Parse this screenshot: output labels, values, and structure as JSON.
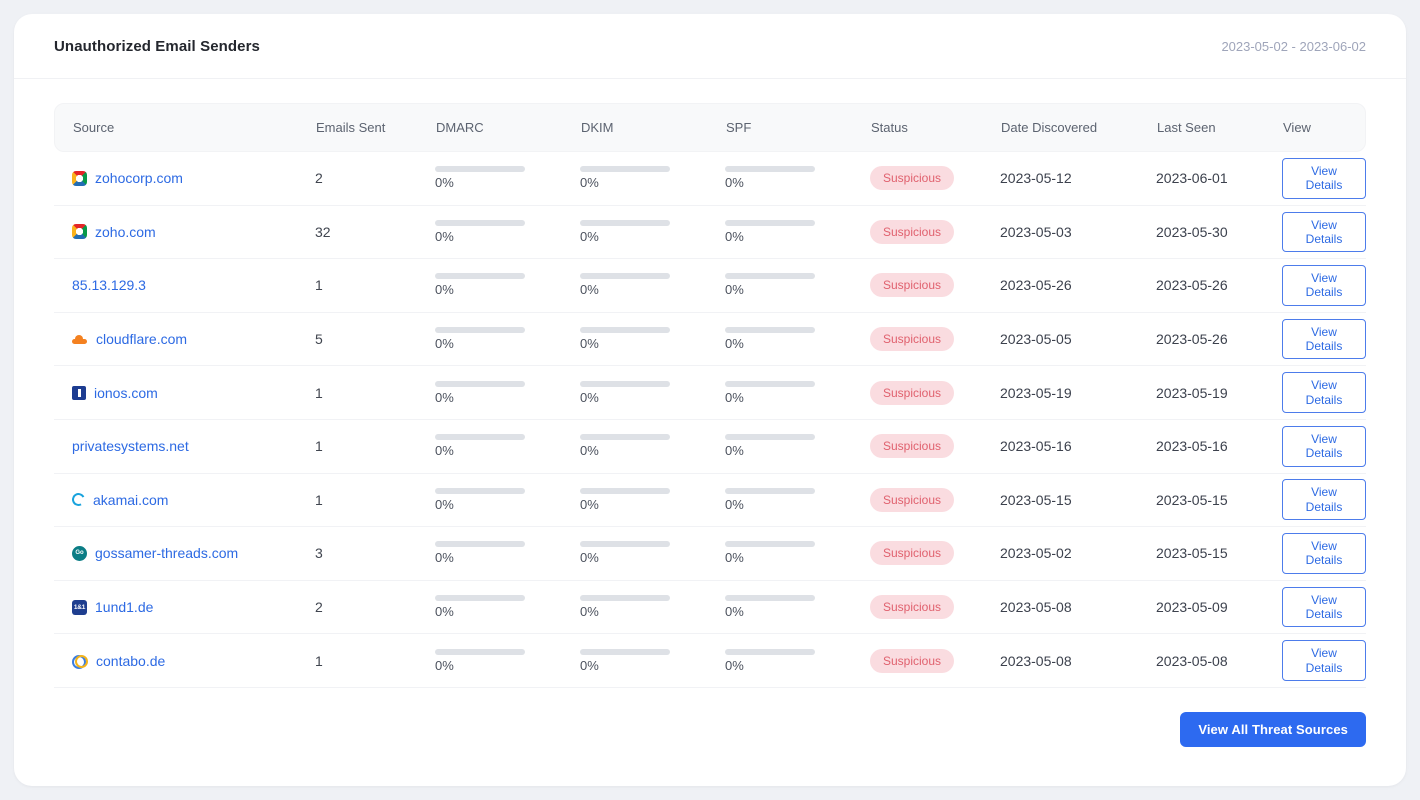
{
  "header": {
    "title": "Unauthorized Email Senders",
    "date_range": "2023-05-02 - 2023-06-02"
  },
  "table": {
    "columns": [
      "Source",
      "Emails Sent",
      "DMARC",
      "DKIM",
      "SPF",
      "Status",
      "Date Discovered",
      "Last Seen",
      "View"
    ],
    "rows": [
      {
        "source": "zohocorp.com",
        "icon": "zoho",
        "emails_sent": "2",
        "dmarc": "0%",
        "dkim": "0%",
        "spf": "0%",
        "status": "Suspicious",
        "date_discovered": "2023-05-12",
        "last_seen": "2023-06-01",
        "view_label": "View Details"
      },
      {
        "source": "zoho.com",
        "icon": "zoho",
        "emails_sent": "32",
        "dmarc": "0%",
        "dkim": "0%",
        "spf": "0%",
        "status": "Suspicious",
        "date_discovered": "2023-05-03",
        "last_seen": "2023-05-30",
        "view_label": "View Details"
      },
      {
        "source": "85.13.129.3",
        "icon": null,
        "emails_sent": "1",
        "dmarc": "0%",
        "dkim": "0%",
        "spf": "0%",
        "status": "Suspicious",
        "date_discovered": "2023-05-26",
        "last_seen": "2023-05-26",
        "view_label": "View Details"
      },
      {
        "source": "cloudflare.com",
        "icon": "cloudflare",
        "emails_sent": "5",
        "dmarc": "0%",
        "dkim": "0%",
        "spf": "0%",
        "status": "Suspicious",
        "date_discovered": "2023-05-05",
        "last_seen": "2023-05-26",
        "view_label": "View Details"
      },
      {
        "source": "ionos.com",
        "icon": "ionos",
        "emails_sent": "1",
        "dmarc": "0%",
        "dkim": "0%",
        "spf": "0%",
        "status": "Suspicious",
        "date_discovered": "2023-05-19",
        "last_seen": "2023-05-19",
        "view_label": "View Details"
      },
      {
        "source": "privatesystems.net",
        "icon": null,
        "emails_sent": "1",
        "dmarc": "0%",
        "dkim": "0%",
        "spf": "0%",
        "status": "Suspicious",
        "date_discovered": "2023-05-16",
        "last_seen": "2023-05-16",
        "view_label": "View Details"
      },
      {
        "source": "akamai.com",
        "icon": "akamai",
        "emails_sent": "1",
        "dmarc": "0%",
        "dkim": "0%",
        "spf": "0%",
        "status": "Suspicious",
        "date_discovered": "2023-05-15",
        "last_seen": "2023-05-15",
        "view_label": "View Details"
      },
      {
        "source": "gossamer-threads.com",
        "icon": "gossamer",
        "emails_sent": "3",
        "dmarc": "0%",
        "dkim": "0%",
        "spf": "0%",
        "status": "Suspicious",
        "date_discovered": "2023-05-02",
        "last_seen": "2023-05-15",
        "view_label": "View Details"
      },
      {
        "source": "1und1.de",
        "icon": "und1",
        "emails_sent": "2",
        "dmarc": "0%",
        "dkim": "0%",
        "spf": "0%",
        "status": "Suspicious",
        "date_discovered": "2023-05-08",
        "last_seen": "2023-05-09",
        "view_label": "View Details"
      },
      {
        "source": "contabo.de",
        "icon": "contabo",
        "emails_sent": "1",
        "dmarc": "0%",
        "dkim": "0%",
        "spf": "0%",
        "status": "Suspicious",
        "date_discovered": "2023-05-08",
        "last_seen": "2023-05-08",
        "view_label": "View Details"
      }
    ]
  },
  "icon_glyphs": {
    "und1": "1&1",
    "gossamer": "Go"
  },
  "footer": {
    "view_all_label": "View All Threat Sources"
  },
  "colors": {
    "accent": "#2d6af0",
    "link": "#2d6ae3",
    "badge_bg": "#fadce0",
    "badge_text": "#e0616e",
    "meter_track": "#dee1e6"
  }
}
